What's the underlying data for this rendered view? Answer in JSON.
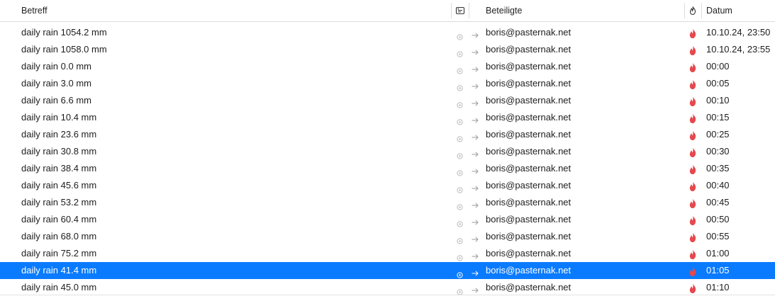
{
  "columns": {
    "betreff": "Betreff",
    "beteiligte": "Beteiligte",
    "datum": "Datum",
    "attachment_icon": "attachment-header-icon",
    "junk_icon": "junk-status-header-icon"
  },
  "colors": {
    "selection": "#0a7bff",
    "flame": "#e5484d"
  },
  "rows": [
    {
      "subject": "daily rain 1054.2 mm",
      "email": "boris@pasternak.net",
      "date": "10.10.24, 23:50"
    },
    {
      "subject": "daily rain 1058.0 mm",
      "email": "boris@pasternak.net",
      "date": "10.10.24, 23:55"
    },
    {
      "subject": "daily rain 0.0 mm",
      "email": "boris@pasternak.net",
      "date": "00:00"
    },
    {
      "subject": "daily rain 3.0 mm",
      "email": "boris@pasternak.net",
      "date": "00:05"
    },
    {
      "subject": "daily rain 6.6 mm",
      "email": "boris@pasternak.net",
      "date": "00:10"
    },
    {
      "subject": "daily rain 10.4 mm",
      "email": "boris@pasternak.net",
      "date": "00:15"
    },
    {
      "subject": "daily rain 23.6 mm",
      "email": "boris@pasternak.net",
      "date": "00:25"
    },
    {
      "subject": "daily rain 30.8 mm",
      "email": "boris@pasternak.net",
      "date": "00:30"
    },
    {
      "subject": "daily rain 38.4 mm",
      "email": "boris@pasternak.net",
      "date": "00:35"
    },
    {
      "subject": "daily rain 45.6 mm",
      "email": "boris@pasternak.net",
      "date": "00:40"
    },
    {
      "subject": "daily rain 53.2 mm",
      "email": "boris@pasternak.net",
      "date": "00:45"
    },
    {
      "subject": "daily rain 60.4 mm",
      "email": "boris@pasternak.net",
      "date": "00:50"
    },
    {
      "subject": "daily rain 68.0 mm",
      "email": "boris@pasternak.net",
      "date": "00:55"
    },
    {
      "subject": "daily rain 75.2 mm",
      "email": "boris@pasternak.net",
      "date": "01:00"
    },
    {
      "subject": "daily rain 41.4 mm",
      "email": "boris@pasternak.net",
      "date": "01:05",
      "selected": true
    },
    {
      "subject": "daily rain 45.0 mm",
      "email": "boris@pasternak.net",
      "date": "01:10"
    }
  ]
}
